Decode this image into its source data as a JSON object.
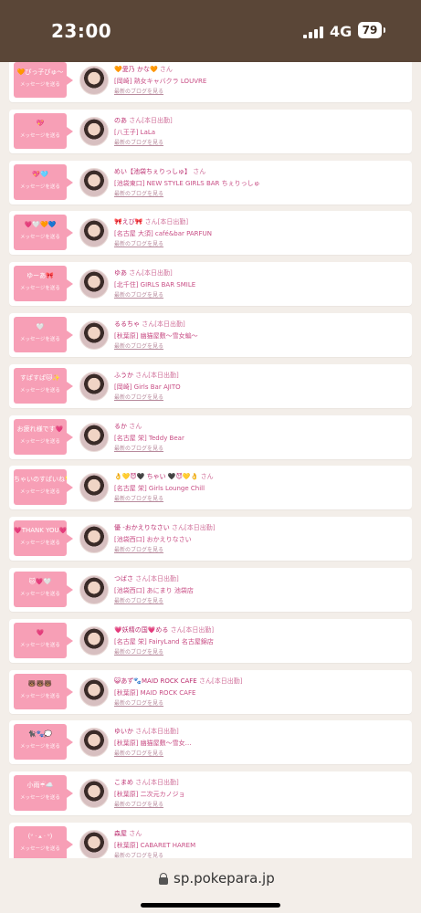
{
  "status_bar": {
    "time": "23:00",
    "network": "4G",
    "battery": "79"
  },
  "colors": {
    "status_bg": "#5a4637",
    "button_pink": "#f79fb6",
    "name_pink": "#bc2f70",
    "page_bg": "#f3eee9"
  },
  "icons": {
    "lock": "lock-icon",
    "signal": "signal-bars-icon",
    "battery": "battery-icon"
  },
  "browser": {
    "url": "sp.pokepara.jp"
  },
  "entries": [
    {
      "deco": "🧡ぴっ子ぴゅ〜",
      "msg": "メッセージを送る",
      "name": "🧡愛乃 かな🧡",
      "suffix": "さん",
      "shop": "[岡崎] 熟女キャバクラ LOUVRE",
      "blog": "最新のブログを見る"
    },
    {
      "deco": "💖",
      "msg": "メッセージを送る",
      "name": "のあ",
      "suffix": "さん[本日出勤]",
      "shop": "[八王子] LaLa",
      "blog": "最新のブログを見る"
    },
    {
      "deco": "💖🩵",
      "msg": "メッセージを送る",
      "name": "めい【池袋ちぇりっしゅ】",
      "suffix": "さん",
      "shop": "[池袋東口] NEW STYLE GIRLS BAR ちぇりっしゅ",
      "blog": "最新のブログを見る"
    },
    {
      "deco": "💗🤍🧡💙",
      "msg": "メッセージを送る",
      "name": "🎀えび🎀",
      "suffix": "さん[本日出勤]",
      "shop": "[名古屋 大須] café&bar PARFUN",
      "blog": "最新のブログを見る"
    },
    {
      "deco": "ゆーあ🎀",
      "msg": "メッセージを送る",
      "name": "ゆあ",
      "suffix": "さん[本日出勤]",
      "shop": "[北千住] GIRLS BAR SMILE",
      "blog": "最新のブログを見る"
    },
    {
      "deco": "🤍",
      "msg": "メッセージを送る",
      "name": "るるちゃ",
      "suffix": "さん[本日出勤]",
      "shop": "[秋葉原] 幽猫屋敷〜雪女編〜",
      "blog": "最新のブログを見る"
    },
    {
      "deco": "すぱすぱ🐱✨",
      "msg": "メッセージを送る",
      "name": "ふうか",
      "suffix": "さん[本日出勤]",
      "shop": "[岡崎] Girls Bar AJITO",
      "blog": "最新のブログを見る"
    },
    {
      "deco": "お疲れ様です💗",
      "msg": "メッセージを送る",
      "name": "るか",
      "suffix": "さん",
      "shop": "[名古屋 栄] Teddy Bear",
      "blog": "最新のブログを見る"
    },
    {
      "deco": "ちゃいのすぱいね💛😈🖤",
      "msg": "メッセージを送る",
      "name": "👌💛😈🖤 ちゃい 🖤😈💛👌",
      "suffix": "さん",
      "shop": "[名古屋 栄] Girls Lounge Chill",
      "blog": "最新のブログを見る"
    },
    {
      "deco": "💗THANK YOU💗",
      "msg": "メッセージを送る",
      "name": "優 -おかえりなさい",
      "suffix": "さん[本日出勤]",
      "shop": "[池袋西口] おかえりなさい",
      "blog": "最新のブログを見る"
    },
    {
      "deco": "🐱💗🤍",
      "msg": "メッセージを送る",
      "name": "つばさ",
      "suffix": "さん[本日出勤]",
      "shop": "[池袋西口] あにまり 池袋店",
      "blog": "最新のブログを見る"
    },
    {
      "deco": "💗",
      "msg": "メッセージを送る",
      "name": "💗妖精の国💗める",
      "suffix": "さん[本日出勤]",
      "shop": "[名古屋 栄] FairyLand 名古屋錦店",
      "blog": "最新のブログを見る"
    },
    {
      "deco": "🐻🐻🐻",
      "msg": "メッセージを送る",
      "name": "😺あず🐾MAID ROCK CAFE",
      "suffix": "さん[本日出勤]",
      "shop": "[秋葉原] MAID ROCK CAFE",
      "blog": "最新のブログを見る"
    },
    {
      "deco": "🐈‍⬛🐾💭",
      "msg": "メッセージを送る",
      "name": "ゆいか",
      "suffix": "さん[本日出勤]",
      "shop": "[秋葉原] 幽猫屋敷〜雪女…",
      "blog": "最新のブログを見る"
    },
    {
      "deco": "小雨☔☁️",
      "msg": "メッセージを送る",
      "name": "こまめ",
      "suffix": "さん[本日出勤]",
      "shop": "[秋葉原] 二次元カノジョ",
      "blog": "最新のブログを見る"
    },
    {
      "deco": "(ᐡ ᐧ ﻌ ᐧ ᐡ)",
      "msg": "メッセージを送る",
      "name": "森屋",
      "suffix": "さん",
      "shop": "[秋葉原] CABARET HAREM",
      "blog": "最新のブログを見る"
    }
  ]
}
